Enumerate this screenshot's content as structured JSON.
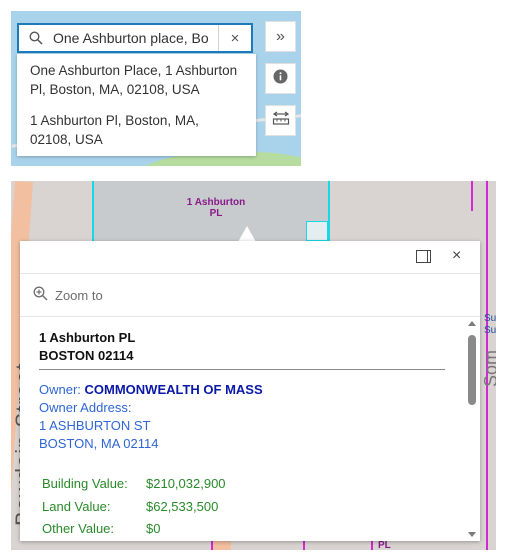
{
  "search": {
    "value": "One Ashburton place, Bo",
    "clear_symbol": "×",
    "suggestions": [
      {
        "line1": "One Ashburton Place, 1 Ashburton",
        "line2": "Pl, Boston, MA, 02108, USA"
      },
      {
        "line1": "1 Ashburton Pl, Boston, MA,",
        "line2": "02108, USA"
      }
    ]
  },
  "tools": {
    "expand_symbol": "»",
    "info_icon": "info-icon",
    "measure_icon": "measure-icon"
  },
  "map": {
    "parcel_label_line1": "1 Ashburton",
    "parcel_label_line2": "PL",
    "street_label": "Bowdoin Street",
    "right_label_1": "Su",
    "right_label_2": "Su",
    "right_label_3": "Som",
    "bottom_label": "PL"
  },
  "popup": {
    "zoom_label": "Zoom to",
    "close_symbol": "×",
    "address_line1": "1 Ashburton PL",
    "address_line2": "BOSTON 02114",
    "owner_label": "Owner: ",
    "owner_value": "COMMONWEALTH OF MASS",
    "owner_address_label": "Owner Address:",
    "owner_address_line1": "1 ASHBURTON ST",
    "owner_address_line2": "BOSTON, MA 02114",
    "values": [
      {
        "label": "Building Value:",
        "value": "$210,032,900"
      },
      {
        "label": "Land Value:",
        "value": "$62,533,500"
      },
      {
        "label": "Other Value:",
        "value": "$0"
      }
    ]
  }
}
